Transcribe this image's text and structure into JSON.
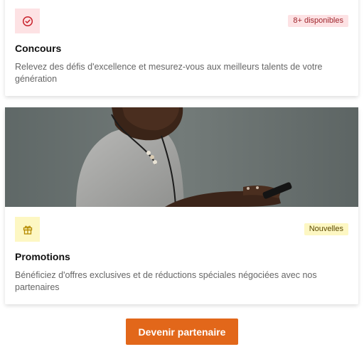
{
  "cards": [
    {
      "icon": "check-circle-icon",
      "accent_color": "#fde2e4",
      "badge": "8+ disponibles",
      "title": "Concours",
      "description": "Relevez des défis d'excellence et mesurez-vous aux meilleurs talents de votre génération"
    },
    {
      "icon": "gift-icon",
      "accent_color": "#fdf7c3",
      "badge": "Nouvelles",
      "title": "Promotions",
      "description": "Bénéficiez d'offres exclusives et de réductions spéciales négociées avec nos partenaires"
    }
  ],
  "cta": {
    "label": "Devenir partenaire",
    "color": "#e2671a"
  }
}
